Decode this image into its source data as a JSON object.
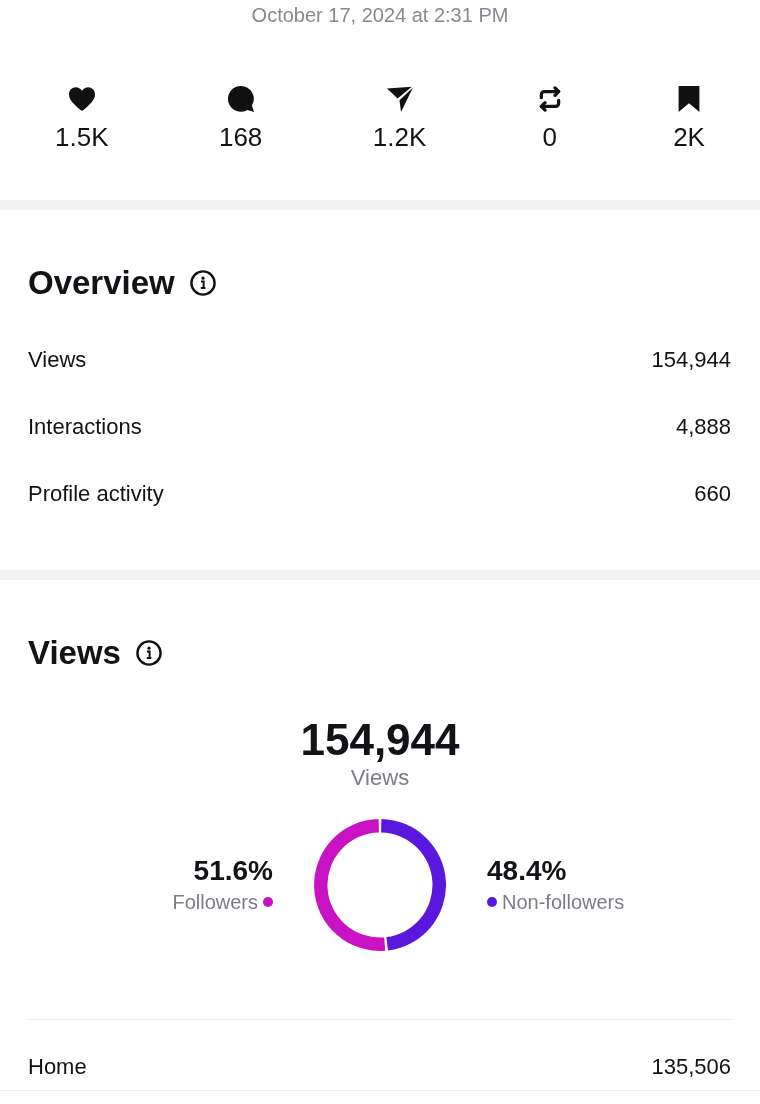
{
  "timestamp": "October 17, 2024 at 2:31 PM",
  "engagement": [
    {
      "kind": "like",
      "count": "1.5K"
    },
    {
      "kind": "comment",
      "count": "168"
    },
    {
      "kind": "share",
      "count": "1.2K"
    },
    {
      "kind": "repost",
      "count": "0"
    },
    {
      "kind": "save",
      "count": "2K"
    }
  ],
  "overview": {
    "title": "Overview",
    "rows": [
      {
        "label": "Views",
        "value": "154,944"
      },
      {
        "label": "Interactions",
        "value": "4,888"
      },
      {
        "label": "Profile activity",
        "value": "660"
      }
    ]
  },
  "views": {
    "title": "Views",
    "total": "154,944",
    "total_label": "Views",
    "chart_data": {
      "type": "donut",
      "categories": [
        "Followers",
        "Non-followers"
      ],
      "values": [
        51.6,
        48.4
      ]
    },
    "legend": [
      {
        "percent": "51.6%",
        "color": "#c812c4"
      },
      {
        "percent": "48.4%",
        "color": "#5a17de"
      }
    ],
    "rows": [
      {
        "label": "Home",
        "value": "135,506"
      }
    ]
  }
}
